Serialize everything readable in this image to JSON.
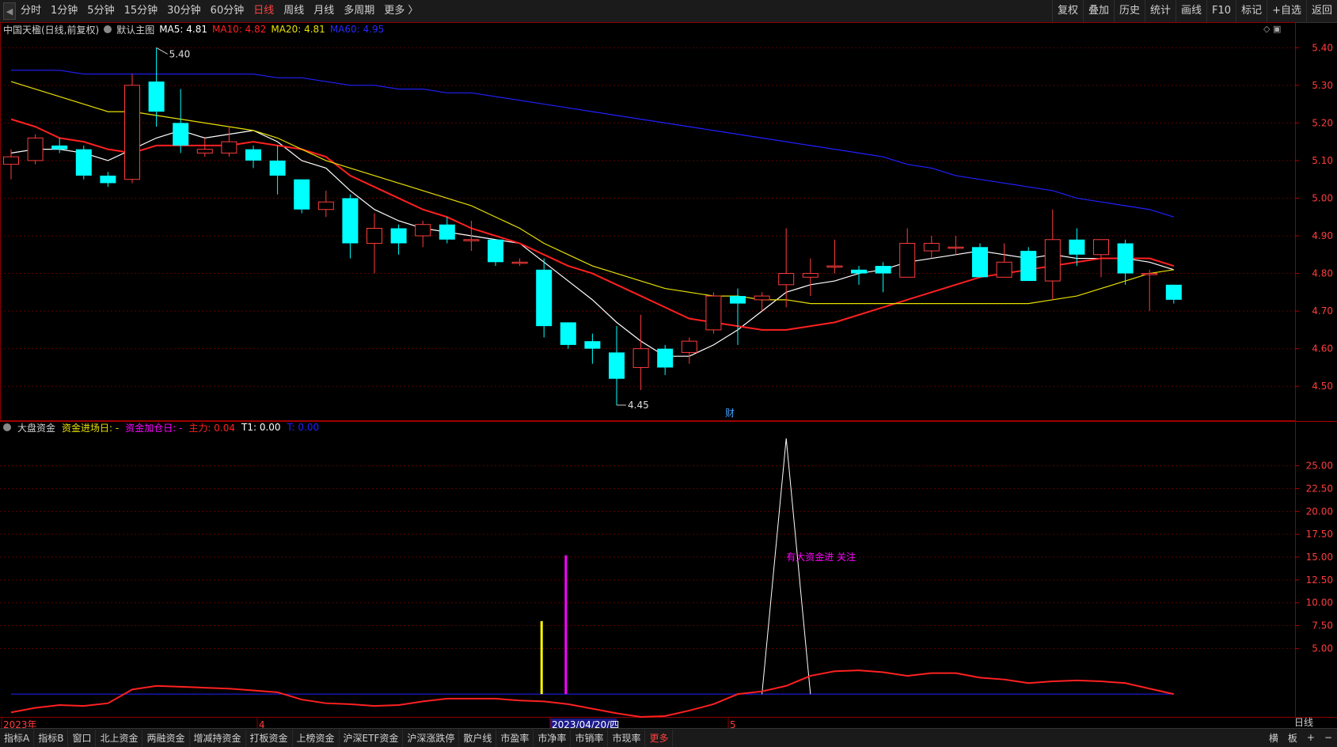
{
  "toolbar": {
    "periods": [
      "分时",
      "1分钟",
      "5分钟",
      "15分钟",
      "30分钟",
      "60分钟",
      "日线",
      "周线",
      "月线",
      "多周期",
      "更多 〉"
    ],
    "active_period": 6,
    "buttons": [
      "复权",
      "叠加",
      "历史",
      "统计",
      "画线",
      "F10",
      "标记",
      "+自选",
      "返回"
    ]
  },
  "main_legend": {
    "name": "中国天楹(日线,前复权)",
    "template": "默认主图",
    "ma5": "MA5: 4.81",
    "ma10": "MA10: 4.82",
    "ma20": "MA20: 4.81",
    "ma60": "MA60: 4.95"
  },
  "sub_legend": {
    "name": "大盘资金",
    "entry": "资金进场日: -",
    "add": "资金加仓日: -",
    "main": "主力: 0.04",
    "t1": "T1: 0.00",
    "t2": "T: 0.00"
  },
  "bottom_tabs": [
    "指标A",
    "指标B",
    "窗口",
    "北上资金",
    "两融资金",
    "增减持资金",
    "打板资金",
    "上榜资金",
    "沪深ETF资金",
    "沪深涨跌停",
    "散户线",
    "市盈率",
    "市净率",
    "市销率",
    "市现率",
    "更多"
  ],
  "bottom_right": [
    "横",
    "板",
    "+",
    "−"
  ],
  "period_label": "日线",
  "colors": {
    "up": "#ff3c3c",
    "down": "#00ffff",
    "ma5": "#ffffff",
    "ma10": "#ff2020",
    "ma20": "#e8e000",
    "ma60": "#2020ff"
  },
  "chart_data": [
    {
      "type": "candlestick",
      "title": "中国天楹(日线,前复权)",
      "y_ticks": [
        5.4,
        5.3,
        5.2,
        5.1,
        5.0,
        4.9,
        4.8,
        4.7,
        4.6,
        4.5
      ],
      "ylim": [
        4.41,
        5.43
      ],
      "annotations": {
        "high": "5.40",
        "low": "4.45",
        "marker": "财"
      },
      "x_labels": [
        "2023年",
        "4",
        "2023/04/20/四",
        "5"
      ],
      "candles": [
        {
          "o": 5.09,
          "c": 5.11,
          "h": 5.13,
          "l": 5.05
        },
        {
          "o": 5.1,
          "c": 5.16,
          "h": 5.17,
          "l": 5.09
        },
        {
          "o": 5.14,
          "c": 5.13,
          "h": 5.16,
          "l": 5.12
        },
        {
          "o": 5.13,
          "c": 5.06,
          "h": 5.14,
          "l": 5.05
        },
        {
          "o": 5.06,
          "c": 5.04,
          "h": 5.07,
          "l": 5.03
        },
        {
          "o": 5.05,
          "c": 5.3,
          "h": 5.33,
          "l": 5.04
        },
        {
          "o": 5.31,
          "c": 5.23,
          "h": 5.4,
          "l": 5.19
        },
        {
          "o": 5.2,
          "c": 5.14,
          "h": 5.29,
          "l": 5.12
        },
        {
          "o": 5.12,
          "c": 5.13,
          "h": 5.16,
          "l": 5.11
        },
        {
          "o": 5.12,
          "c": 5.15,
          "h": 5.19,
          "l": 5.11
        },
        {
          "o": 5.13,
          "c": 5.1,
          "h": 5.14,
          "l": 5.08
        },
        {
          "o": 5.1,
          "c": 5.06,
          "h": 5.14,
          "l": 5.01
        },
        {
          "o": 5.05,
          "c": 4.97,
          "h": 5.05,
          "l": 4.96
        },
        {
          "o": 4.97,
          "c": 4.99,
          "h": 5.02,
          "l": 4.95
        },
        {
          "o": 5.0,
          "c": 4.88,
          "h": 5.01,
          "l": 4.84
        },
        {
          "o": 4.88,
          "c": 4.92,
          "h": 4.96,
          "l": 4.8
        },
        {
          "o": 4.92,
          "c": 4.88,
          "h": 4.93,
          "l": 4.85
        },
        {
          "o": 4.9,
          "c": 4.93,
          "h": 4.94,
          "l": 4.87
        },
        {
          "o": 4.93,
          "c": 4.89,
          "h": 4.95,
          "l": 4.88
        },
        {
          "o": 4.89,
          "c": 4.89,
          "h": 4.94,
          "l": 4.86
        },
        {
          "o": 4.89,
          "c": 4.83,
          "h": 4.89,
          "l": 4.82
        },
        {
          "o": 4.83,
          "c": 4.83,
          "h": 4.84,
          "l": 4.82
        },
        {
          "o": 4.81,
          "c": 4.66,
          "h": 4.84,
          "l": 4.63
        },
        {
          "o": 4.67,
          "c": 4.61,
          "h": 4.67,
          "l": 4.6
        },
        {
          "o": 4.62,
          "c": 4.6,
          "h": 4.64,
          "l": 4.56
        },
        {
          "o": 4.59,
          "c": 4.52,
          "h": 4.66,
          "l": 4.45
        },
        {
          "o": 4.55,
          "c": 4.6,
          "h": 4.69,
          "l": 4.49
        },
        {
          "o": 4.6,
          "c": 4.55,
          "h": 4.61,
          "l": 4.53
        },
        {
          "o": 4.59,
          "c": 4.62,
          "h": 4.63,
          "l": 4.56
        },
        {
          "o": 4.65,
          "c": 4.74,
          "h": 4.75,
          "l": 4.64
        },
        {
          "o": 4.74,
          "c": 4.72,
          "h": 4.76,
          "l": 4.61
        },
        {
          "o": 4.73,
          "c": 4.74,
          "h": 4.75,
          "l": 4.7
        },
        {
          "o": 4.77,
          "c": 4.8,
          "h": 4.92,
          "l": 4.71
        },
        {
          "o": 4.79,
          "c": 4.8,
          "h": 4.84,
          "l": 4.74
        },
        {
          "o": 4.82,
          "c": 4.82,
          "h": 4.89,
          "l": 4.8
        },
        {
          "o": 4.81,
          "c": 4.8,
          "h": 4.82,
          "l": 4.77
        },
        {
          "o": 4.82,
          "c": 4.8,
          "h": 4.83,
          "l": 4.75
        },
        {
          "o": 4.79,
          "c": 4.88,
          "h": 4.92,
          "l": 4.79
        },
        {
          "o": 4.86,
          "c": 4.88,
          "h": 4.9,
          "l": 4.84
        },
        {
          "o": 4.87,
          "c": 4.87,
          "h": 4.9,
          "l": 4.85
        },
        {
          "o": 4.87,
          "c": 4.79,
          "h": 4.88,
          "l": 4.79
        },
        {
          "o": 4.79,
          "c": 4.83,
          "h": 4.88,
          "l": 4.8
        },
        {
          "o": 4.86,
          "c": 4.78,
          "h": 4.87,
          "l": 4.78
        },
        {
          "o": 4.78,
          "c": 4.89,
          "h": 4.97,
          "l": 4.73
        },
        {
          "o": 4.89,
          "c": 4.85,
          "h": 4.92,
          "l": 4.82
        },
        {
          "o": 4.85,
          "c": 4.89,
          "h": 4.89,
          "l": 4.79
        },
        {
          "o": 4.88,
          "c": 4.8,
          "h": 4.89,
          "l": 4.77
        },
        {
          "o": 4.8,
          "c": 4.8,
          "h": 4.81,
          "l": 4.7
        },
        {
          "o": 4.77,
          "c": 4.73,
          "h": 4.77,
          "l": 4.72
        }
      ],
      "series": [
        {
          "name": "MA5",
          "values": [
            5.12,
            5.13,
            5.13,
            5.12,
            5.1,
            5.13,
            5.16,
            5.18,
            5.16,
            5.17,
            5.18,
            5.15,
            5.1,
            5.08,
            5.02,
            4.97,
            4.94,
            4.92,
            4.91,
            4.9,
            4.89,
            4.88,
            4.83,
            4.78,
            4.73,
            4.67,
            4.62,
            4.58,
            4.58,
            4.61,
            4.65,
            4.7,
            4.75,
            4.77,
            4.78,
            4.8,
            4.81,
            4.83,
            4.84,
            4.85,
            4.86,
            4.85,
            4.84,
            4.85,
            4.84,
            4.84,
            4.84,
            4.83,
            4.81
          ]
        },
        {
          "name": "MA10",
          "values": [
            5.21,
            5.19,
            5.16,
            5.15,
            5.13,
            5.12,
            5.14,
            5.14,
            5.14,
            5.14,
            5.15,
            5.14,
            5.13,
            5.11,
            5.06,
            5.03,
            5.0,
            4.97,
            4.95,
            4.92,
            4.9,
            4.88,
            4.85,
            4.82,
            4.8,
            4.77,
            4.74,
            4.71,
            4.68,
            4.67,
            4.66,
            4.65,
            4.65,
            4.66,
            4.67,
            4.69,
            4.71,
            4.73,
            4.75,
            4.77,
            4.79,
            4.8,
            4.81,
            4.82,
            4.83,
            4.84,
            4.84,
            4.84,
            4.82
          ]
        },
        {
          "name": "MA20",
          "values": [
            5.31,
            5.29,
            5.27,
            5.25,
            5.23,
            5.23,
            5.22,
            5.21,
            5.2,
            5.19,
            5.18,
            5.16,
            5.13,
            5.1,
            5.08,
            5.06,
            5.04,
            5.02,
            5.0,
            4.98,
            4.95,
            4.92,
            4.88,
            4.85,
            4.82,
            4.8,
            4.78,
            4.76,
            4.75,
            4.74,
            4.74,
            4.73,
            4.73,
            4.72,
            4.72,
            4.72,
            4.72,
            4.72,
            4.72,
            4.72,
            4.72,
            4.72,
            4.72,
            4.73,
            4.74,
            4.76,
            4.78,
            4.8,
            4.81
          ]
        },
        {
          "name": "MA60",
          "values": [
            5.34,
            5.34,
            5.34,
            5.33,
            5.33,
            5.33,
            5.33,
            5.33,
            5.33,
            5.33,
            5.33,
            5.32,
            5.32,
            5.31,
            5.3,
            5.3,
            5.29,
            5.29,
            5.28,
            5.28,
            5.27,
            5.26,
            5.25,
            5.24,
            5.23,
            5.22,
            5.21,
            5.2,
            5.19,
            5.18,
            5.17,
            5.16,
            5.15,
            5.14,
            5.13,
            5.12,
            5.11,
            5.09,
            5.08,
            5.06,
            5.05,
            5.04,
            5.03,
            5.02,
            5.0,
            4.99,
            4.98,
            4.97,
            4.95
          ]
        }
      ]
    },
    {
      "type": "line",
      "title": "大盘资金",
      "y_ticks": [
        25.0,
        22.5,
        20.0,
        17.5,
        15.0,
        12.5,
        10.0,
        7.5,
        5.0
      ],
      "ylim": [
        -2.5,
        28
      ],
      "annotation": "有大资金进 关注",
      "spike": {
        "index": 32,
        "value": 28
      },
      "bars": [
        {
          "index": 22,
          "value": 8.0,
          "color": "#ffff00"
        },
        {
          "index": 23,
          "value": 15.2,
          "color": "#ff00ff"
        }
      ],
      "series": [
        {
          "name": "主力",
          "values": [
            -2.0,
            -1.5,
            -1.2,
            -1.3,
            -1.0,
            0.5,
            0.9,
            0.8,
            0.7,
            0.6,
            0.4,
            0.2,
            -0.6,
            -1.0,
            -1.1,
            -1.3,
            -1.2,
            -0.8,
            -0.5,
            -0.5,
            -0.5,
            -0.7,
            -0.8,
            -1.1,
            -1.6,
            -2.1,
            -2.5,
            -2.4,
            -1.8,
            -1.1,
            0.0,
            0.3,
            0.9,
            2.0,
            2.5,
            2.6,
            2.4,
            2.0,
            2.3,
            2.3,
            1.8,
            1.6,
            1.2,
            1.4,
            1.5,
            1.4,
            1.2,
            0.6,
            0.0
          ]
        }
      ]
    }
  ]
}
